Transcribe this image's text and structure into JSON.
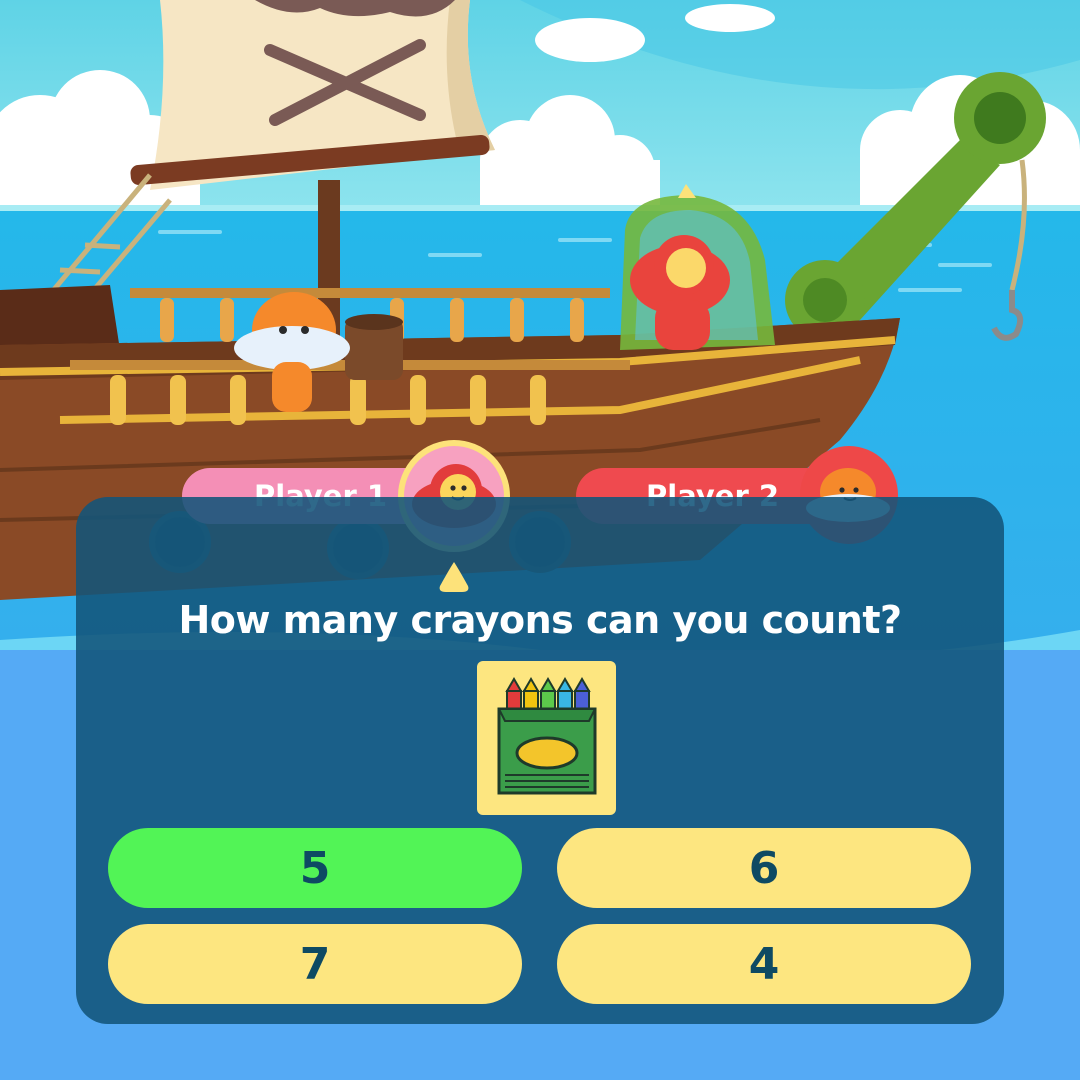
{
  "players": [
    {
      "label": "Player 1"
    },
    {
      "label": "Player 2"
    }
  ],
  "question": "How many crayons can you count?",
  "answers": [
    "5",
    "6",
    "7",
    "4"
  ],
  "selected_answer": "5",
  "colors": {
    "player1": "#f48fb6",
    "player2": "#ef4a4f",
    "selected_answer": "#52f456",
    "answer": "#fde680",
    "panel": "#12547a"
  },
  "crayon_colors": [
    "#e23b3b",
    "#f1c40f",
    "#5cc94b",
    "#39b6e3",
    "#4b5fd6"
  ]
}
